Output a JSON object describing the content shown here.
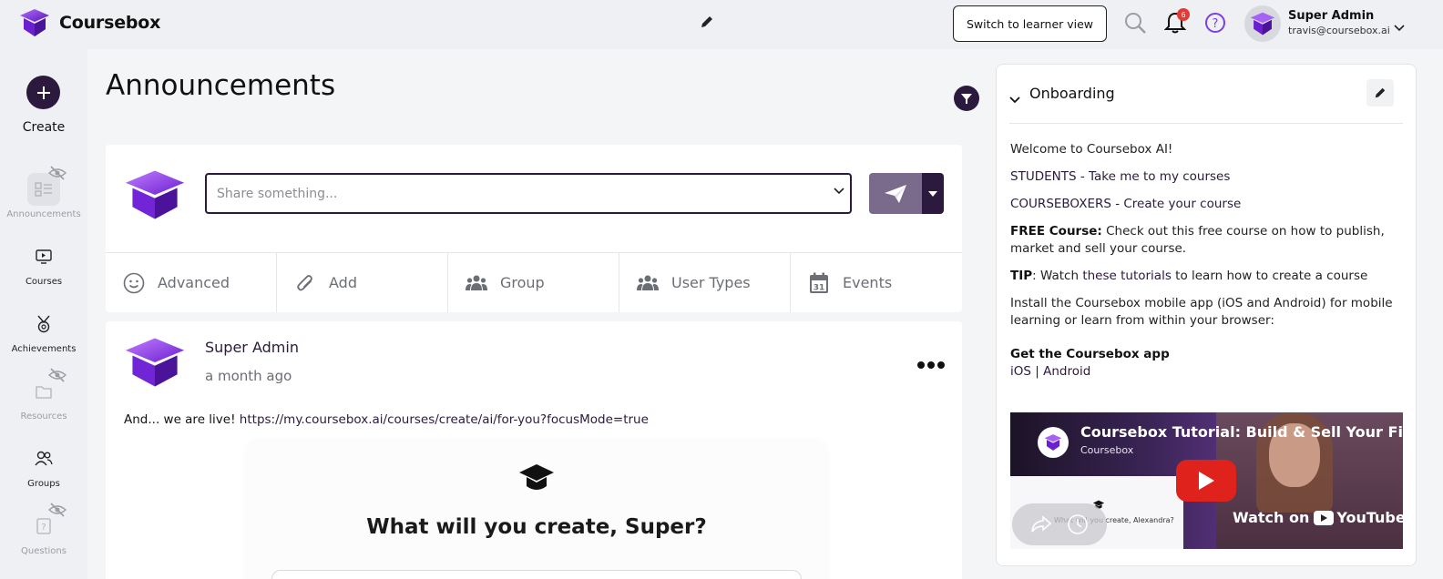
{
  "topbar": {
    "app_name": "Coursebox",
    "learner_button": "Switch to learner view",
    "notification_count": "6",
    "user_name": "Super Admin",
    "user_email": "travis@coursebox.ai"
  },
  "sidebar": {
    "create_label": "Create",
    "items": [
      {
        "label": "Announcements",
        "hidden": true,
        "active": true
      },
      {
        "label": "Courses",
        "hidden": false
      },
      {
        "label": "Achievements",
        "hidden": false
      },
      {
        "label": "Resources",
        "hidden": true
      },
      {
        "label": "Groups",
        "hidden": false
      },
      {
        "label": "Questions",
        "hidden": true
      }
    ]
  },
  "main": {
    "title": "Announcements",
    "composer": {
      "placeholder": "Share something...",
      "tabs": [
        {
          "label": "Advanced",
          "icon": "smiley-icon"
        },
        {
          "label": "Add",
          "icon": "paperclip-icon"
        },
        {
          "label": "Group",
          "icon": "group-icon"
        },
        {
          "label": "User Types",
          "icon": "user-types-icon"
        },
        {
          "label": "Events",
          "icon": "calendar-icon",
          "day": "31"
        }
      ]
    },
    "post": {
      "author": "Super Admin",
      "time": "a month ago",
      "text": "And... we are live! ",
      "link": "https://my.coursebox.ai/courses/create/ai/for-you?focusMode=true",
      "preview_title": "What will you create, Super?"
    }
  },
  "onboarding": {
    "title": "Onboarding",
    "welcome": "Welcome to Coursebox AI!",
    "students_link": "STUDENTS - Take me to my courses",
    "creators_link": "COURSEBOXERS - Create your course",
    "free_label": "FREE Course:",
    "free_text": " Check out this free course on how to publish, market and sell your course.",
    "tip_label": "TIP",
    "tip_pre": ": Watch ",
    "tip_link": "these tutorials",
    "tip_post": " to learn how to create a course",
    "install_text": "Install the Coursebox mobile app (iOS and Android) for mobile learning or learn from within your browser:",
    "get_app": "Get the Coursebox app",
    "ios": "iOS",
    "sep": " | ",
    "android": "Android",
    "video": {
      "title": "Coursebox Tutorial: Build & Sell Your First C",
      "channel": "Coursebox",
      "slide_text": "What will you create, Alexandra?",
      "watch_on": "Watch on",
      "youtube": "YouTube"
    }
  },
  "colors": {
    "brand_dark": "#2b1a3d",
    "brand_purple": "#7b3fe4",
    "send_button": "#7a6a8c",
    "badge": "#e53935"
  }
}
